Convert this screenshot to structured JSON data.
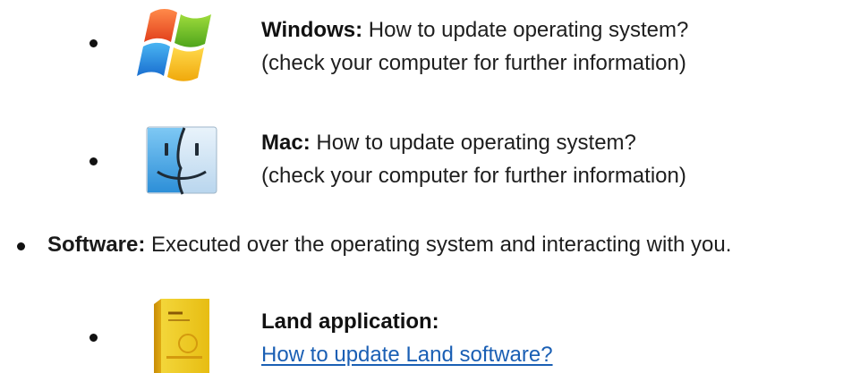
{
  "items": [
    {
      "icon": "windows-logo-icon",
      "title": "Windows:",
      "line1": "How to update operating system?",
      "line2": "(check your computer for further information)"
    },
    {
      "icon": "mac-finder-icon",
      "title": "Mac:",
      "line1": "How to update operating system?",
      "line2": "(check your computer for further information)"
    }
  ],
  "software": {
    "title": "Software:",
    "description": "Executed over the operating system and interacting with you."
  },
  "land": {
    "icon": "land-software-box-icon",
    "title": "Land application:",
    "link": "How to update Land software?"
  }
}
